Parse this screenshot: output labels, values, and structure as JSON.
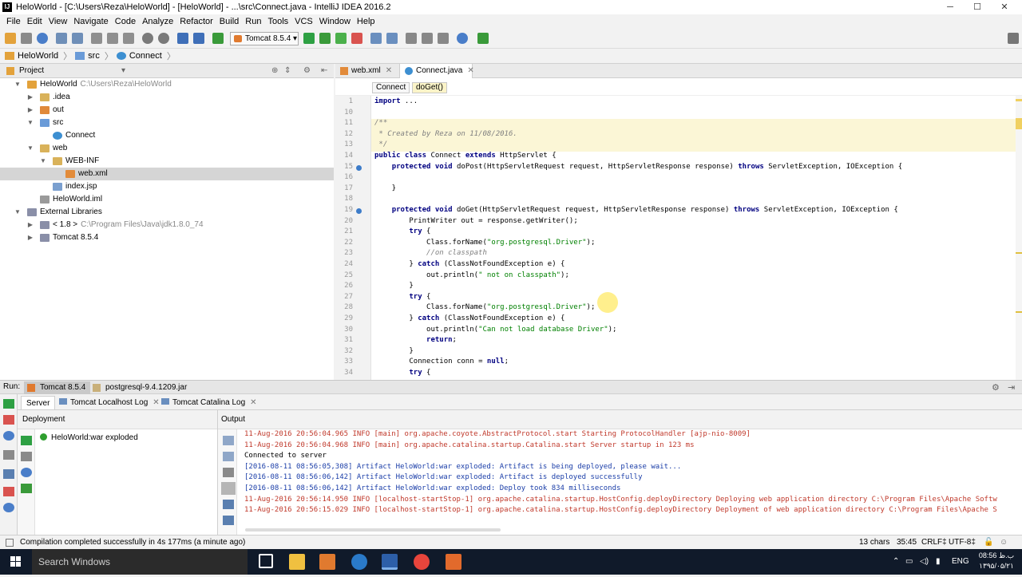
{
  "window": {
    "title": "HeloWorld - [C:\\Users\\Reza\\HeloWorld] - [HeloWorld] - ...\\src\\Connect.java - IntelliJ IDEA 2016.2",
    "controls": {
      "minimize": "─",
      "maximize": "☐",
      "close": "✕"
    }
  },
  "menu": [
    "File",
    "Edit",
    "View",
    "Navigate",
    "Code",
    "Analyze",
    "Refactor",
    "Build",
    "Run",
    "Tools",
    "VCS",
    "Window",
    "Help"
  ],
  "toolbar": {
    "run_config": "Tomcat 8.5.4 ▾"
  },
  "breadcrumb": [
    "HeloWorld",
    "src",
    "Connect"
  ],
  "project_panel": {
    "title": "Project",
    "tree": [
      {
        "label": "HeloWorld",
        "extra": "C:\\Users\\Reza\\HeloWorld",
        "depth": 0,
        "expanded": true,
        "icon": "module"
      },
      {
        "label": ".idea",
        "extra": "",
        "depth": 1,
        "expanded": false,
        "icon": "folder"
      },
      {
        "label": "out",
        "extra": "",
        "depth": 1,
        "expanded": false,
        "icon": "folder-orange"
      },
      {
        "label": "src",
        "extra": "",
        "depth": 1,
        "expanded": true,
        "icon": "folder-blue"
      },
      {
        "label": "Connect",
        "extra": "",
        "depth": 2,
        "expanded": null,
        "icon": "class"
      },
      {
        "label": "web",
        "extra": "",
        "depth": 1,
        "expanded": true,
        "icon": "folder"
      },
      {
        "label": "WEB-INF",
        "extra": "",
        "depth": 2,
        "expanded": true,
        "icon": "folder"
      },
      {
        "label": "web.xml",
        "extra": "",
        "depth": 3,
        "expanded": null,
        "icon": "xml",
        "selected": true
      },
      {
        "label": "index.jsp",
        "extra": "",
        "depth": 2,
        "expanded": null,
        "icon": "jsp"
      },
      {
        "label": "HeloWorld.iml",
        "extra": "",
        "depth": 1,
        "expanded": null,
        "icon": "iml"
      },
      {
        "label": "External Libraries",
        "extra": "",
        "depth": 0,
        "expanded": true,
        "icon": "library"
      },
      {
        "label": "< 1.8 >",
        "extra": "C:\\Program Files\\Java\\jdk1.8.0_74",
        "depth": 1,
        "expanded": false,
        "icon": "library"
      },
      {
        "label": "Tomcat 8.5.4",
        "extra": "",
        "depth": 1,
        "expanded": false,
        "icon": "library"
      }
    ]
  },
  "editor": {
    "tabs": [
      {
        "label": "web.xml",
        "active": false
      },
      {
        "label": "Connect.java",
        "active": true
      }
    ],
    "crumbs": [
      "Connect",
      "doGet()"
    ],
    "lines": [
      {
        "n": "1",
        "text": "import ..."
      },
      {
        "n": "10",
        "text": ""
      },
      {
        "n": "11",
        "text": "/**"
      },
      {
        "n": "12",
        "text": " * Created by Reza on 11/08/2016."
      },
      {
        "n": "13",
        "text": " */"
      },
      {
        "n": "14",
        "text": "public class Connect extends HttpServlet {"
      },
      {
        "n": "15",
        "text": "    protected void doPost(HttpServletRequest request, HttpServletResponse response) throws ServletException, IOException {"
      },
      {
        "n": "16",
        "text": ""
      },
      {
        "n": "17",
        "text": "    }"
      },
      {
        "n": "18",
        "text": ""
      },
      {
        "n": "19",
        "text": "    protected void doGet(HttpServletRequest request, HttpServletResponse response) throws ServletException, IOException {"
      },
      {
        "n": "20",
        "text": "        PrintWriter out = response.getWriter();"
      },
      {
        "n": "21",
        "text": "        try {"
      },
      {
        "n": "22",
        "text": "            Class.forName(\"org.postgresql.Driver\");"
      },
      {
        "n": "23",
        "text": "            //on classpath"
      },
      {
        "n": "24",
        "text": "        } catch (ClassNotFoundException e) {"
      },
      {
        "n": "25",
        "text": "            out.println(\" not on classpath\");"
      },
      {
        "n": "26",
        "text": "        }"
      },
      {
        "n": "27",
        "text": "        try {"
      },
      {
        "n": "28",
        "text": "            Class.forName(\"org.postgresql.Driver\");"
      },
      {
        "n": "29",
        "text": "        } catch (ClassNotFoundException e) {"
      },
      {
        "n": "30",
        "text": "            out.println(\"Can not load database Driver\");"
      },
      {
        "n": "31",
        "text": "            return;"
      },
      {
        "n": "32",
        "text": "        }"
      },
      {
        "n": "33",
        "text": "        Connection conn = null;"
      },
      {
        "n": "34",
        "text": "        try {"
      }
    ]
  },
  "run": {
    "label": "Run:",
    "tabs": [
      "Tomcat 8.5.4",
      "postgresql-9.4.1209.jar"
    ],
    "subtabs": [
      "Server",
      "Tomcat Localhost Log",
      "Tomcat Catalina Log"
    ],
    "deployment_header": "Deployment",
    "output_header": "Output",
    "artifact": "HeloWorld:war exploded",
    "output_lines": [
      {
        "text": "11-Aug-2016 20:56:04.965 INFO [main] org.apache.coyote.AbstractProtocol.start Starting ProtocolHandler [ajp-nio-8009]",
        "style": "red"
      },
      {
        "text": "11-Aug-2016 20:56:04.968 INFO [main] org.apache.catalina.startup.Catalina.start Server startup in 123 ms",
        "style": "red"
      },
      {
        "text": "Connected to server",
        "style": "black"
      },
      {
        "text": "[2016-08-11 08:56:05,308] Artifact HeloWorld:war exploded: Artifact is being deployed, please wait...",
        "style": "blue"
      },
      {
        "text": "[2016-08-11 08:56:06,142] Artifact HeloWorld:war exploded: Artifact is deployed successfully",
        "style": "blue"
      },
      {
        "text": "[2016-08-11 08:56:06,142] Artifact HeloWorld:war exploded: Deploy took 834 milliseconds",
        "style": "blue"
      },
      {
        "text": "11-Aug-2016 20:56:14.950 INFO [localhost-startStop-1] org.apache.catalina.startup.HostConfig.deployDirectory Deploying web application directory C:\\Program Files\\Apache Softw",
        "style": "red"
      },
      {
        "text": "11-Aug-2016 20:56:15.029 INFO [localhost-startStop-1] org.apache.catalina.startup.HostConfig.deployDirectory Deployment of web application directory C:\\Program Files\\Apache S",
        "style": "red"
      }
    ]
  },
  "status": {
    "message": "Compilation completed successfully in 4s 177ms (a minute ago)",
    "chars": "13 chars",
    "position": "35:45",
    "line_sep": "CRLF‡",
    "encoding": "UTF-8‡"
  },
  "taskbar": {
    "search_placeholder": "Search Windows",
    "lang": "ENG",
    "time": "08:56 ب.ظ",
    "date": "۱۳۹۵/۰۵/۲۱"
  },
  "colors": {
    "accent": "#3574c6",
    "selection": "#d5d5d5",
    "doc_highlight": "#fbf6d6",
    "taskbar": "#101a2a"
  }
}
